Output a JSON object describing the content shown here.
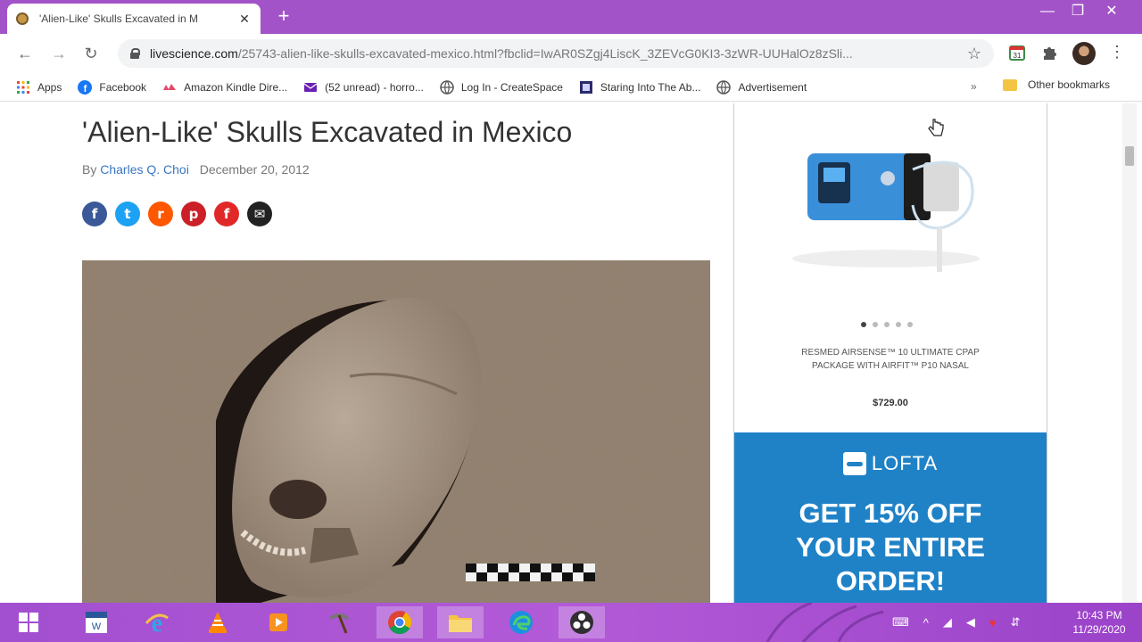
{
  "browser": {
    "tab_title": "'Alien-Like' Skulls Excavated in M",
    "url_domain": "livescience.com",
    "url_path": "/25743-alien-like-skulls-excavated-mexico.html?fbclid=IwAR0SZgj4LiscK_3ZEVcG0KI3-3zWR-UUHalOz8zSli..."
  },
  "bookmarks": [
    {
      "label": "Apps",
      "icon": "apps-grid-icon"
    },
    {
      "label": "Facebook",
      "icon": "facebook-icon"
    },
    {
      "label": "Amazon Kindle Dire...",
      "icon": "kindle-icon"
    },
    {
      "label": "(52 unread) - horro...",
      "icon": "mail-icon"
    },
    {
      "label": "Log In - CreateSpace",
      "icon": "globe-icon"
    },
    {
      "label": "Staring Into The Ab...",
      "icon": "blog-icon"
    },
    {
      "label": "Advertisement",
      "icon": "globe-icon"
    }
  ],
  "bookmarks_more": "»",
  "other_bookmarks": "Other bookmarks",
  "article": {
    "title": "'Alien-Like' Skulls Excavated in Mexico",
    "byline_prefix": "By",
    "author": "Charles Q. Choi",
    "date": "December 20, 2012",
    "shares": [
      {
        "name": "facebook",
        "glyph": "f",
        "color": "#3b5998"
      },
      {
        "name": "twitter",
        "glyph": "t",
        "color": "#1da1f2"
      },
      {
        "name": "reddit",
        "glyph": "r",
        "color": "#ff5700"
      },
      {
        "name": "pinterest",
        "glyph": "p",
        "color": "#cb2027"
      },
      {
        "name": "flipboard",
        "glyph": "f",
        "color": "#e12828"
      },
      {
        "name": "email",
        "glyph": "✉",
        "color": "#222222"
      }
    ]
  },
  "ad": {
    "product": "RESMED AIRSENSE™ 10 ULTIMATE CPAP PACKAGE WITH AIRFIT™ P10 NASAL",
    "price": "$729.00",
    "carousel_total": 5,
    "carousel_active": 1,
    "brand": "LOFTA",
    "headline": "GET 15% OFF YOUR ENTIRE ORDER!"
  },
  "taskbar": {
    "time": "10:43 PM",
    "date": "11/29/2020",
    "apps": [
      "start",
      "word",
      "internet-explorer",
      "vlc",
      "media-player",
      "tools",
      "chrome",
      "file-explorer",
      "edge",
      "obs"
    ]
  }
}
